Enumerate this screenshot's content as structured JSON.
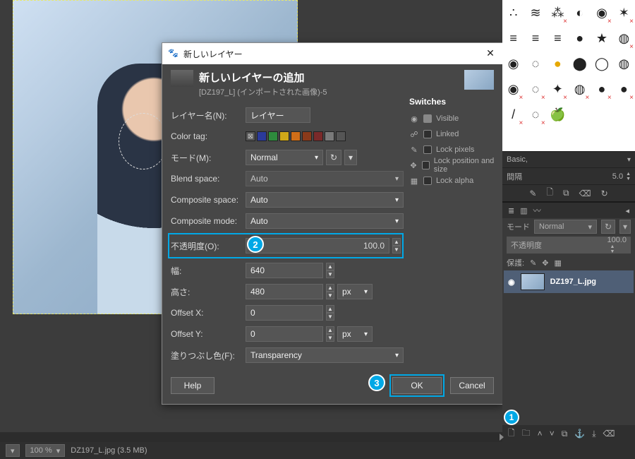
{
  "dialog": {
    "window_title": "新しいレイヤー",
    "header_title": "新しいレイヤーの追加",
    "header_sub": "[DZ197_L] (インポートされた画像)-5",
    "labels": {
      "layer_name": "レイヤー名(N):",
      "color_tag": "Color tag:",
      "mode": "モード(M):",
      "blend_space": "Blend space:",
      "composite_space": "Composite space:",
      "composite_mode": "Composite mode:",
      "opacity": "不透明度(O):",
      "width": "幅:",
      "height": "高さ:",
      "offset_x": "Offset X:",
      "offset_y": "Offset Y:",
      "fill": "塗りつぶし色(F):"
    },
    "values": {
      "layer_name": "レイヤー",
      "mode": "Normal",
      "blend_space": "Auto",
      "composite_space": "Auto",
      "composite_mode": "Auto",
      "opacity": "100.0",
      "width": "640",
      "height": "480",
      "height_unit": "px",
      "offset_x": "0",
      "offset_y": "0",
      "offset_y_unit": "px",
      "fill": "Transparency"
    },
    "color_tags": [
      "#555",
      "#2b3a9a",
      "#2e8b3d",
      "#d0a818",
      "#d06e18",
      "#8a3a1a",
      "#7a2a2a",
      "#7a7a7a",
      "#555"
    ],
    "switches": {
      "heading": "Switches",
      "items": [
        {
          "icon": "eye",
          "label": "Visible",
          "checked": true
        },
        {
          "icon": "link",
          "label": "Linked",
          "checked": false
        },
        {
          "icon": "brush",
          "label": "Lock pixels",
          "checked": false
        },
        {
          "icon": "move",
          "label": "Lock position and size",
          "checked": false
        },
        {
          "icon": "alpha",
          "label": "Lock alpha",
          "checked": false
        }
      ]
    },
    "buttons": {
      "help": "Help",
      "ok": "OK",
      "cancel": "Cancel"
    }
  },
  "right": {
    "preset_label": "Basic,",
    "spacing_label": "間隔",
    "spacing_value": "5.0",
    "layers": {
      "mode_label": "モード",
      "mode_value": "Normal",
      "opacity_label": "不透明度",
      "opacity_value": "100.0",
      "lock_label": "保護:",
      "layer_name": "DZ197_L.jpg"
    }
  },
  "status": {
    "zoom": "100 %",
    "file": "DZ197_L.jpg (3.5 MB)"
  },
  "badges": {
    "b1": "1",
    "b2": "2",
    "b3": "3"
  }
}
